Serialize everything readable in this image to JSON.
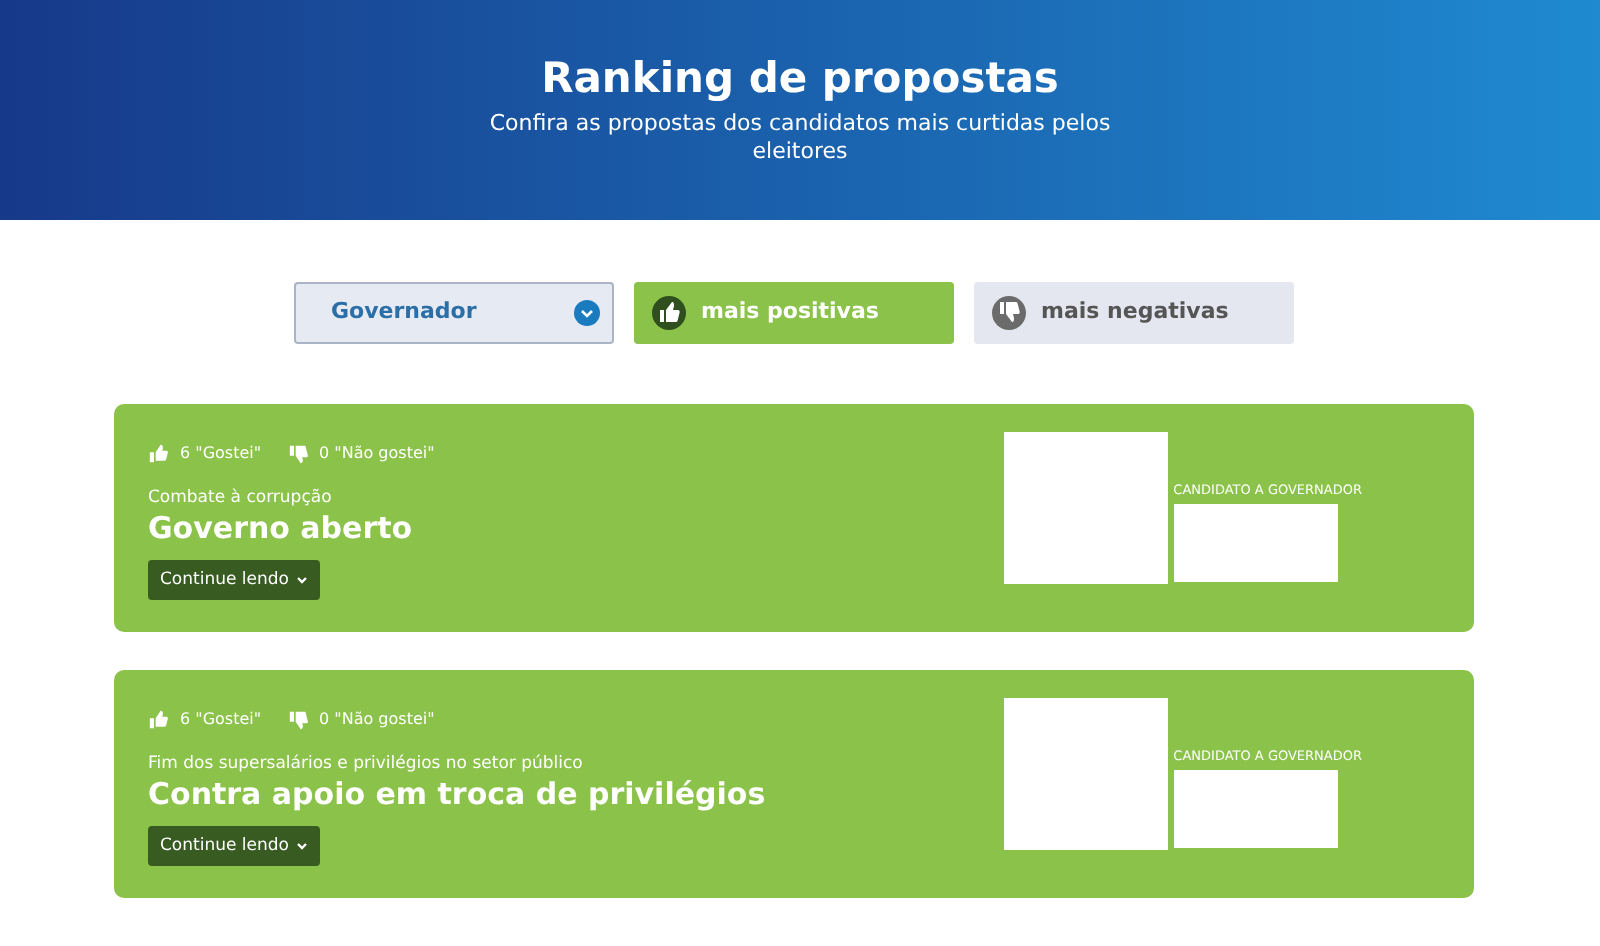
{
  "header": {
    "title": "Ranking de propostas",
    "subtitle": "Confira as propostas dos candidatos mais curtidas pelos eleitores"
  },
  "filters": {
    "select": {
      "value": "Governador"
    },
    "options": [
      {
        "kind": "up",
        "label": "mais positivas",
        "selected": true
      },
      {
        "kind": "down",
        "label": "mais negativas",
        "selected": false
      }
    ]
  },
  "proposals": [
    {
      "likes": "6 \"Gostei\"",
      "dislikes": "0 \"Não gostei\"",
      "category": "Combate à corrupção",
      "title": "Governo aberto",
      "button": "Continue lendo",
      "role": "CANDIDATO A GOVERNADOR"
    },
    {
      "likes": "6 \"Gostei\"",
      "dislikes": "0 \"Não gostei\"",
      "category": "Fim dos supersalários e privilégios no setor público",
      "title": "Contra apoio em troca de privilégios",
      "button": "Continue lendo",
      "role": "CANDIDATO A GOVERNADOR"
    }
  ]
}
